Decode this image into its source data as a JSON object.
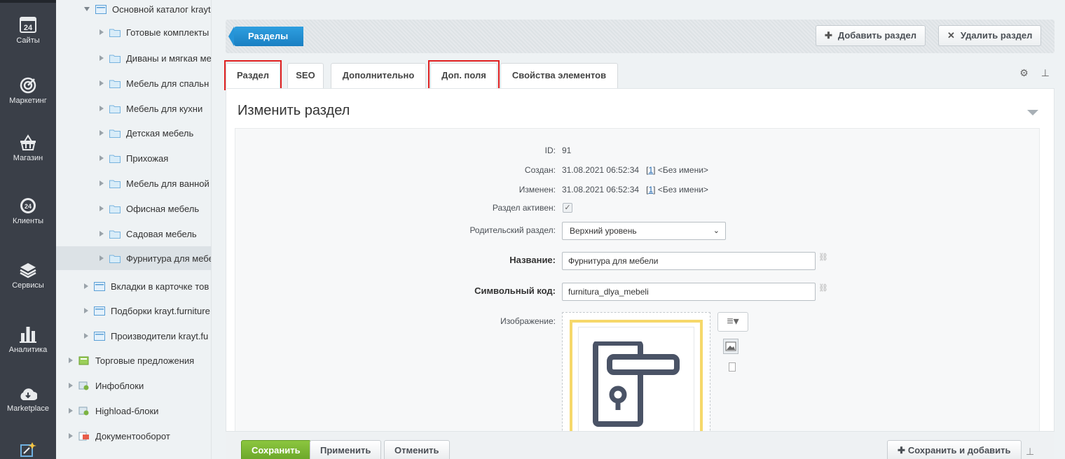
{
  "leftbar": {
    "items": [
      {
        "label": "Сайты",
        "icon": "calendar-24-icon"
      },
      {
        "label": "Маркетинг",
        "icon": "target-icon"
      },
      {
        "label": "Магазин",
        "icon": "basket-icon"
      },
      {
        "label": "Клиенты",
        "icon": "clients-24-icon"
      },
      {
        "label": "Сервисы",
        "icon": "layers-icon"
      },
      {
        "label": "Аналитика",
        "icon": "bar-chart-icon"
      },
      {
        "label": "Marketplace",
        "icon": "cloud-download-icon"
      }
    ],
    "calendar_number": "24",
    "clients_number": "24"
  },
  "tree": {
    "items": [
      {
        "label": "Основной каталог krayt",
        "level": 1
      },
      {
        "label": "Готовые комплекты",
        "level": 2
      },
      {
        "label": "Диваны и мягкая ме",
        "level": 2
      },
      {
        "label": "Мебель для спальн",
        "level": 2
      },
      {
        "label": "Мебель для кухни",
        "level": 2
      },
      {
        "label": "Детская мебель",
        "level": 2
      },
      {
        "label": "Прихожая",
        "level": 2
      },
      {
        "label": "Мебель для ванной",
        "level": 2
      },
      {
        "label": "Офисная мебель",
        "level": 2
      },
      {
        "label": "Садовая мебель",
        "level": 2
      },
      {
        "label": "Фурнитура для мебе",
        "level": 2
      },
      {
        "label": "Вкладки в карточке тов",
        "level": 1
      },
      {
        "label": "Подборки krayt.furniture",
        "level": 1
      },
      {
        "label": "Производители krayt.fu",
        "level": 1
      },
      {
        "label": "Торговые предложения",
        "level": 0
      },
      {
        "label": "Инфоблоки",
        "level": 0
      },
      {
        "label": "Highload-блоки",
        "level": 0
      },
      {
        "label": "Документооборот",
        "level": 0
      }
    ]
  },
  "toolbar": {
    "breadcrumb": "Разделы",
    "add_section": "Добавить раздел",
    "delete_section": "Удалить раздел"
  },
  "tabs": [
    {
      "label": "Раздел"
    },
    {
      "label": "SEO"
    },
    {
      "label": "Дополнительно"
    },
    {
      "label": "Доп. поля"
    },
    {
      "label": "Свойства элементов"
    }
  ],
  "panel": {
    "title": "Изменить раздел"
  },
  "form": {
    "id_label": "ID:",
    "id_value": "91",
    "created_label": "Создан:",
    "created_value": "31.08.2021 06:52:34",
    "created_user_link": "1",
    "created_user_name": "<Без имени>",
    "modified_label": "Изменен:",
    "modified_value": "31.08.2021 06:52:34",
    "modified_user_link": "1",
    "modified_user_name": "<Без имени>",
    "active_label": "Раздел активен:",
    "active_checked": true,
    "parent_label": "Родительский раздел:",
    "parent_value": "Верхний уровень",
    "name_label": "Название:",
    "name_value": "Фурнитура для мебели",
    "code_label": "Символьный код:",
    "code_value": "furnitura_dlya_mebeli",
    "image_label": "Изображение:"
  },
  "footer": {
    "save": "Сохранить",
    "apply": "Применить",
    "cancel": "Отменить",
    "save_and_add": "Сохранить и добавить"
  },
  "colors": {
    "sidebar": "#3a3f48",
    "accent_blue": "#1a7fc2",
    "save_green": "#6aa629",
    "highlight_red": "#e02020",
    "image_frame": "#f6d86a"
  }
}
